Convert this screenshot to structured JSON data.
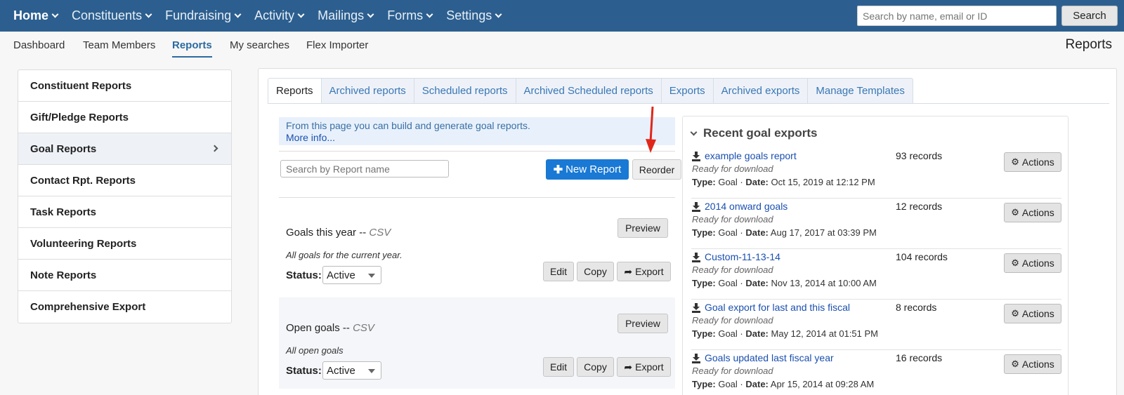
{
  "topnav": {
    "items": [
      {
        "label": "Home"
      },
      {
        "label": "Constituents"
      },
      {
        "label": "Fundraising"
      },
      {
        "label": "Activity"
      },
      {
        "label": "Mailings"
      },
      {
        "label": "Forms"
      },
      {
        "label": "Settings"
      }
    ],
    "search_placeholder": "Search by name, email or ID",
    "search_button": "Search"
  },
  "subnav": {
    "items": [
      {
        "label": "Dashboard"
      },
      {
        "label": "Team Members"
      },
      {
        "label": "Reports",
        "active": true
      },
      {
        "label": "My searches"
      },
      {
        "label": "Flex Importer"
      }
    ],
    "page_title": "Reports"
  },
  "sidebar": {
    "items": [
      {
        "label": "Constituent Reports"
      },
      {
        "label": "Gift/Pledge Reports"
      },
      {
        "label": "Goal Reports",
        "active": true
      },
      {
        "label": "Contact Rpt. Reports"
      },
      {
        "label": "Task Reports"
      },
      {
        "label": "Volunteering Reports"
      },
      {
        "label": "Note Reports"
      },
      {
        "label": "Comprehensive Export"
      }
    ]
  },
  "tabs": [
    {
      "label": "Reports",
      "active": true
    },
    {
      "label": "Archived reports"
    },
    {
      "label": "Scheduled reports"
    },
    {
      "label": "Archived Scheduled reports"
    },
    {
      "label": "Exports"
    },
    {
      "label": "Archived exports"
    },
    {
      "label": "Manage Templates"
    }
  ],
  "info": {
    "text": "From this page you can build and generate goal reports.",
    "more": "More info..."
  },
  "toolbar": {
    "search_placeholder": "Search by Report name",
    "new_report": "New Report",
    "reorder": "Reorder"
  },
  "reports": [
    {
      "name": "Goals this year --",
      "format": "CSV",
      "description": "All goals for the current year.",
      "status_label": "Status:",
      "status": "Active",
      "preview": "Preview",
      "edit": "Edit",
      "copy": "Copy",
      "export": "Export"
    },
    {
      "name": "Open goals --",
      "format": "CSV",
      "description": "All open goals",
      "status_label": "Status:",
      "status": "Active",
      "preview": "Preview",
      "edit": "Edit",
      "copy": "Copy",
      "export": "Export"
    }
  ],
  "recent": {
    "title": "Recent goal exports",
    "type_label": "Type:",
    "date_label": "Date:",
    "actions_label": "Actions",
    "items": [
      {
        "name": "example goals report",
        "state": "Ready for download",
        "type": "Goal",
        "date": "Oct 15, 2019 at 12:12 PM",
        "records": "93 records"
      },
      {
        "name": "2014 onward goals",
        "state": "Ready for download",
        "type": "Goal",
        "date": "Aug 17, 2017 at 03:39 PM",
        "records": "12 records"
      },
      {
        "name": "Custom-11-13-14",
        "state": "Ready for download",
        "type": "Goal",
        "date": "Nov 13, 2014 at 10:00 AM",
        "records": "104 records"
      },
      {
        "name": "Goal export for last and this fiscal",
        "state": "Ready for download",
        "type": "Goal",
        "date": "May 12, 2014 at 01:51 PM",
        "records": "8 records"
      },
      {
        "name": "Goals updated last fiscal year",
        "state": "Ready for download",
        "type": "Goal",
        "date": "Apr 15, 2014 at 09:28 AM",
        "records": "16 records"
      }
    ]
  },
  "colors": {
    "nav_bg": "#2c5f8f",
    "primary_button": "#1979d4",
    "link": "#1a4fb0",
    "annotation_arrow": "#e0261b"
  }
}
